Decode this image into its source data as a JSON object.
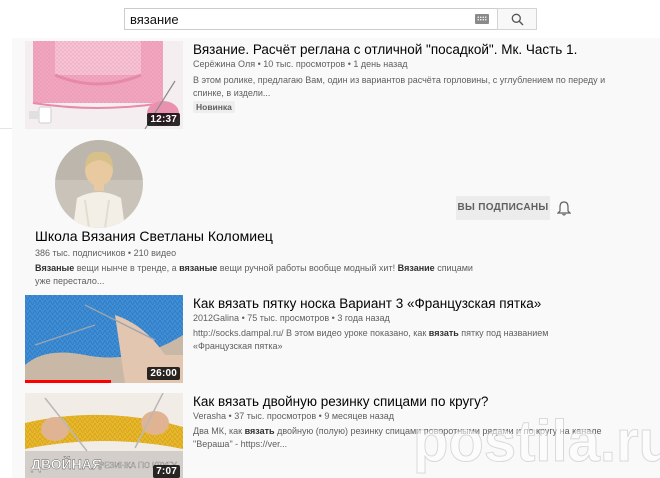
{
  "search": {
    "query": "вязание"
  },
  "videos": [
    {
      "title": "Вязание. Расчёт реглана с отличной \"посадкой\". Мк. Часть 1.",
      "channel": "Серёжина Оля",
      "views": "10 тыс. просмотров",
      "age": "1 день назад",
      "desc_line1": "В этом ролике, предлагаю Вам, один из вариантов расчёта горловины, с углублением по переду и",
      "desc_line2": "спинке, в издели...",
      "badge": "Новинка",
      "duration": "12:37"
    },
    {
      "title": "Как вязать пятку носка Вариант 3 «Французская пятка»",
      "channel": "2012Galina",
      "views": "75 тыс. просмотров",
      "age": "3 года назад",
      "desc_line1_a": "http://socks.dampal.ru/ В этом видео уроке показано, как ",
      "desc_line1_b": "вязать",
      "desc_line1_c": " пятку под названием",
      "desc_line2": "«Французская пятка»",
      "duration": "26:00"
    },
    {
      "title": "Как вязать двойную резинку спицами по кругу?",
      "channel": "Verasha",
      "views": "37 тыс. просмотров",
      "age": "9 месяцев назад",
      "desc_line1_a": "Два МК, как ",
      "desc_line1_b": "вязать",
      "desc_line1_c": " двойную (полую) резинку спицами поворотными рядами и по кругу на канале",
      "desc_line2": "\"Вераша\" - https://ver...",
      "duration": "7:07",
      "thumb_caption_a": "ДВОЙНАЯ",
      "thumb_caption_b": "РЕЗИНКА ПО КРУГУ"
    }
  ],
  "channel": {
    "name": "Школа Вязания Светланы Коломиец",
    "subscribers": "386 тыс. подписчиков",
    "videos": "210 видео",
    "desc_1": "Вязаные",
    "desc_2": " вещи нынче в тренде, а ",
    "desc_3": "вязаные",
    "desc_4": " вещи ручной работы вообще модный хит! ",
    "desc_5": "Вязание",
    "desc_6": " спицами",
    "desc_line2": "уже перестало...",
    "subscribed_label": "ВЫ ПОДПИСАНЫ"
  },
  "separator": "•",
  "watermark": "postila.ru",
  "colors": {
    "thumb_pink": "#f2a7c0",
    "thumb_blue": "#3e8fd6",
    "thumb_yellow": "#e8b82a",
    "progress_red": "#ff0000"
  }
}
